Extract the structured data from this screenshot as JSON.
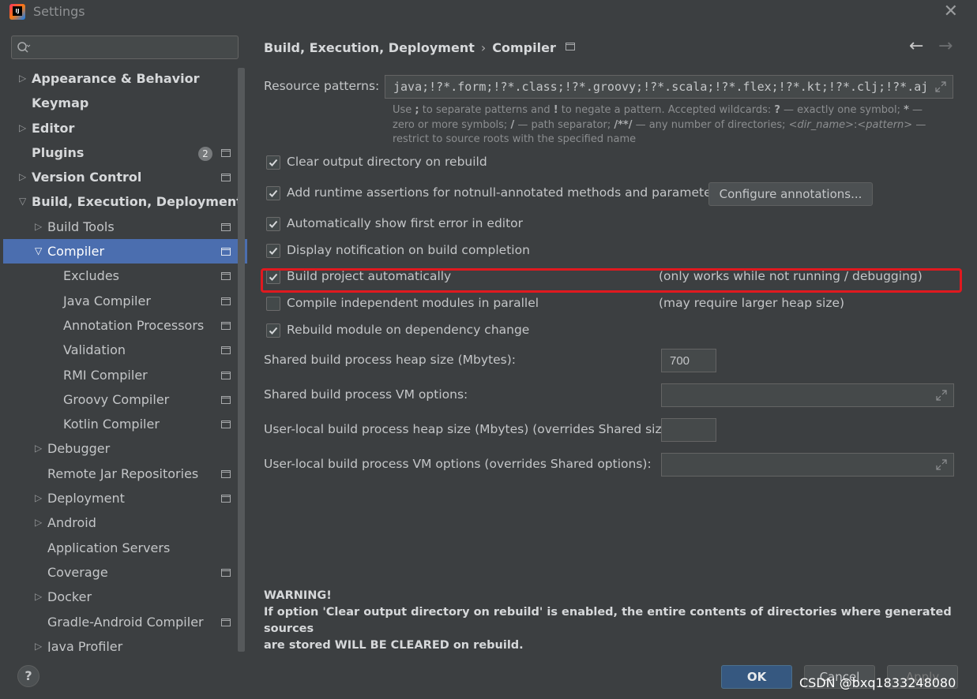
{
  "window": {
    "title": "Settings",
    "close_glyph": "✕"
  },
  "search": {
    "placeholder": ""
  },
  "tree": [
    {
      "label": "Appearance & Behavior",
      "level": 0,
      "arrow": "right",
      "bold": true
    },
    {
      "label": "Keymap",
      "level": 0,
      "bold": true
    },
    {
      "label": "Editor",
      "level": 0,
      "arrow": "right",
      "bold": true
    },
    {
      "label": "Plugins",
      "level": 0,
      "bold": true,
      "badge": "2",
      "page_icon": true
    },
    {
      "label": "Version Control",
      "level": 0,
      "arrow": "right",
      "bold": true,
      "page_icon": true
    },
    {
      "label": "Build, Execution, Deployment",
      "level": 0,
      "arrow": "down",
      "bold": true
    },
    {
      "label": "Build Tools",
      "level": 1,
      "arrow": "right",
      "page_icon": true
    },
    {
      "label": "Compiler",
      "level": 1,
      "arrow": "down",
      "selected": true,
      "page_icon": true
    },
    {
      "label": "Excludes",
      "level": 2,
      "page_icon": true
    },
    {
      "label": "Java Compiler",
      "level": 2,
      "page_icon": true
    },
    {
      "label": "Annotation Processors",
      "level": 2,
      "page_icon": true
    },
    {
      "label": "Validation",
      "level": 2,
      "page_icon": true
    },
    {
      "label": "RMI Compiler",
      "level": 2,
      "page_icon": true
    },
    {
      "label": "Groovy Compiler",
      "level": 2,
      "page_icon": true
    },
    {
      "label": "Kotlin Compiler",
      "level": 2,
      "page_icon": true
    },
    {
      "label": "Debugger",
      "level": 1,
      "arrow": "right"
    },
    {
      "label": "Remote Jar Repositories",
      "level": 1,
      "page_icon": true
    },
    {
      "label": "Deployment",
      "level": 1,
      "arrow": "right",
      "page_icon": true
    },
    {
      "label": "Android",
      "level": 1,
      "arrow": "right"
    },
    {
      "label": "Application Servers",
      "level": 1
    },
    {
      "label": "Coverage",
      "level": 1,
      "page_icon": true
    },
    {
      "label": "Docker",
      "level": 1,
      "arrow": "right"
    },
    {
      "label": "Gradle-Android Compiler",
      "level": 1,
      "page_icon": true
    },
    {
      "label": "Java Profiler",
      "level": 1,
      "arrow": "right"
    }
  ],
  "breadcrumb": {
    "parent": "Build, Execution, Deployment",
    "separator": "›",
    "current": "Compiler"
  },
  "nav": {
    "back": "←",
    "forward": "→"
  },
  "resource_patterns": {
    "label": "Resource patterns:",
    "value": "java;!?*.form;!?*.class;!?*.groovy;!?*.scala;!?*.flex;!?*.kt;!?*.clj;!?*.aj"
  },
  "hint": {
    "p1": "Use ",
    "semicolon": ";",
    "p2": " to separate patterns and ",
    "bang": "!",
    "p3": " to negate a pattern. Accepted wildcards: ",
    "q": "?",
    "p4": " — exactly one symbol; ",
    "star": "*",
    "p5": " — zero or more symbols; ",
    "slash": "/",
    "p6": " — path separator; ",
    "dstar": "/**/",
    "p7": " — any number of directories; ",
    "dirname": "<dir_name>",
    "colon": ":",
    "pattern": "<pattern>",
    "p8": " — restrict to source roots with the specified name"
  },
  "options": [
    {
      "label": "Clear output directory on rebuild",
      "checked": true
    },
    {
      "label": "Add runtime assertions for notnull-annotated methods and parameters",
      "checked": true
    },
    {
      "label": "Automatically show first error in editor",
      "checked": true
    },
    {
      "label": "Display notification on build completion",
      "checked": true
    },
    {
      "label": "Build project automatically",
      "checked": true,
      "note": "(only works while not running / debugging)"
    },
    {
      "label": "Compile independent modules in parallel",
      "checked": false,
      "note": "(may require larger heap size)"
    },
    {
      "label": "Rebuild module on dependency change",
      "checked": true
    }
  ],
  "configure_button": "Configure annotations...",
  "heap": {
    "label": "Shared build process heap size (Mbytes):",
    "value": "700"
  },
  "vm": {
    "label": "Shared build process VM options:",
    "value": ""
  },
  "user_heap": {
    "label": "User-local build process heap size (Mbytes) (overrides Shared size):",
    "value": ""
  },
  "user_vm": {
    "label": "User-local build process VM options (overrides Shared options):",
    "value": ""
  },
  "warning": {
    "title": "WARNING!",
    "line1": "If option 'Clear output directory on rebuild' is enabled, the entire contents of directories where generated sources",
    "line2": "are stored WILL BE CLEARED on rebuild."
  },
  "footer": {
    "help": "?",
    "ok": "OK",
    "cancel": "Cancel",
    "apply": "Apply"
  },
  "watermark": "CSDN @bxq1833248080",
  "colors": {
    "selection": "#4b6eaf",
    "highlight": "#e0191f",
    "ok_button": "#365880"
  }
}
